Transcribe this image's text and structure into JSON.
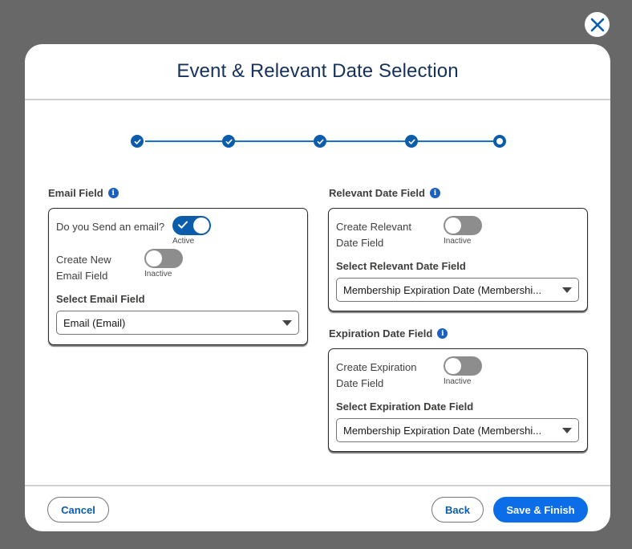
{
  "modal": {
    "title": "Event & Relevant Date Selection",
    "close_icon": "close-icon"
  },
  "stepper": {
    "steps": [
      {
        "status": "complete",
        "icon": "check-icon"
      },
      {
        "status": "complete",
        "icon": "check-icon"
      },
      {
        "status": "complete",
        "icon": "check-icon"
      },
      {
        "status": "complete",
        "icon": "check-icon"
      },
      {
        "status": "current",
        "icon": "current-step-icon"
      }
    ]
  },
  "email": {
    "section_label": "Email Field",
    "send_email_label": "Do you Send an email?",
    "send_email_state": "Active",
    "create_new_label_line1": "Create New",
    "create_new_label_line2": "Email Field",
    "create_new_state": "Inactive",
    "select_label": "Select Email Field",
    "select_value": "Email (Email)"
  },
  "relevant": {
    "section_label": "Relevant Date Field",
    "create_label_line1": "Create Relevant",
    "create_label_line2": "Date Field",
    "create_state": "Inactive",
    "select_label": "Select Relevant Date Field",
    "select_value": "Membership Expiration Date (Membershi..."
  },
  "expiration": {
    "section_label": "Expiration Date Field",
    "create_label_line1": "Create Expiration",
    "create_label_line2": "Date Field",
    "create_state": "Inactive",
    "select_label": "Select Expiration Date Field",
    "select_value": "Membership Expiration Date (Membershi..."
  },
  "footer": {
    "cancel_label": "Cancel",
    "back_label": "Back",
    "save_label": "Save & Finish"
  },
  "colors": {
    "brand": "#0b6ee8",
    "title": "#16325c",
    "overlay": "#686868"
  }
}
